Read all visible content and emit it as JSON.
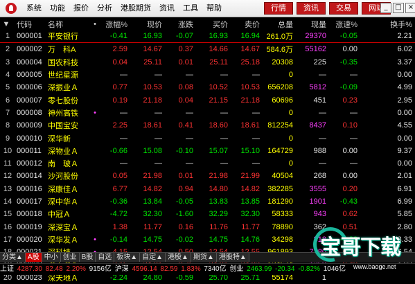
{
  "menu": [
    "系统",
    "功能",
    "报价",
    "分析",
    "港股期货",
    "资讯",
    "工具",
    "帮助"
  ],
  "modes": [
    "行情",
    "资讯",
    "交易",
    "网站"
  ],
  "window_buttons": [
    "_",
    "□",
    "×"
  ],
  "table": {
    "corner": "▼",
    "headers": [
      "",
      "代码",
      "名称",
      "•",
      "涨幅%",
      "现价",
      "涨跌",
      "买价",
      "卖价",
      "总量",
      "现量",
      "涨速%",
      "换手%"
    ],
    "rows": [
      {
        "no": "1",
        "code": "000001",
        "name": "平安银行",
        "mark": "",
        "pct": "-0.41",
        "price": "16.93",
        "chg": "-0.07",
        "bid": "16.93",
        "ask": "16.94",
        "vol": "261.0万",
        "cur": "29370",
        "spd": "-0.05",
        "turn": "2.21",
        "dir": "down",
        "curc": "mag",
        "spdc": "down"
      },
      {
        "no": "2",
        "code": "000002",
        "name": "万　科A",
        "mark": "",
        "pct": "2.59",
        "price": "14.67",
        "chg": "0.37",
        "bid": "14.66",
        "ask": "14.67",
        "vol": "584.6万",
        "cur": "55162",
        "spd": "0.00",
        "turn": "6.02",
        "dir": "up",
        "curc": "mag",
        "spdc": "wht"
      },
      {
        "no": "3",
        "code": "000004",
        "name": "国农科技",
        "mark": "",
        "pct": "0.04",
        "price": "25.11",
        "chg": "0.01",
        "bid": "25.11",
        "ask": "25.18",
        "vol": "20308",
        "cur": "225",
        "spd": "-0.35",
        "turn": "3.37",
        "dir": "up",
        "curc": "wht",
        "spdc": "down"
      },
      {
        "no": "4",
        "code": "000005",
        "name": "世纪星源",
        "mark": "",
        "pct": "—",
        "price": "—",
        "chg": "—",
        "bid": "—",
        "ask": "—",
        "vol": "0",
        "cur": "—",
        "spd": "—",
        "turn": "0.00",
        "dir": "dash",
        "curc": "wht",
        "spdc": "wht"
      },
      {
        "no": "5",
        "code": "000006",
        "name": "深振业Ａ",
        "mark": "",
        "pct": "0.77",
        "price": "10.53",
        "chg": "0.08",
        "bid": "10.52",
        "ask": "10.53",
        "vol": "656208",
        "cur": "5812",
        "spd": "-0.09",
        "turn": "4.99",
        "dir": "up",
        "curc": "mag",
        "spdc": "down"
      },
      {
        "no": "6",
        "code": "000007",
        "name": "零七股份",
        "mark": "",
        "pct": "0.19",
        "price": "21.18",
        "chg": "0.04",
        "bid": "21.15",
        "ask": "21.18",
        "vol": "60696",
        "cur": "451",
        "spd": "0.23",
        "turn": "2.95",
        "dir": "up",
        "curc": "wht",
        "spdc": "up"
      },
      {
        "no": "7",
        "code": "000008",
        "name": "神州高铁",
        "mark": "•",
        "pct": "—",
        "price": "—",
        "chg": "—",
        "bid": "—",
        "ask": "—",
        "vol": "0",
        "cur": "—",
        "spd": "—",
        "turn": "0.00",
        "dir": "dash",
        "curc": "wht",
        "spdc": "wht"
      },
      {
        "no": "8",
        "code": "000009",
        "name": "中国宝安",
        "mark": "",
        "pct": "2.25",
        "price": "18.61",
        "chg": "0.41",
        "bid": "18.60",
        "ask": "18.61",
        "vol": "812254",
        "cur": "8437",
        "spd": "0.10",
        "turn": "4.55",
        "dir": "up",
        "curc": "mag",
        "spdc": "up"
      },
      {
        "no": "9",
        "code": "000010",
        "name": "深华新",
        "mark": "",
        "pct": "—",
        "price": "—",
        "chg": "—",
        "bid": "—",
        "ask": "—",
        "vol": "0",
        "cur": "—",
        "spd": "—",
        "turn": "0.00",
        "dir": "dash",
        "curc": "wht",
        "spdc": "wht"
      },
      {
        "no": "10",
        "code": "000011",
        "name": "深物业Ａ",
        "mark": "",
        "pct": "-0.66",
        "price": "15.08",
        "chg": "-0.10",
        "bid": "15.07",
        "ask": "15.10",
        "vol": "164729",
        "cur": "988",
        "spd": "0.00",
        "turn": "9.37",
        "dir": "down",
        "curc": "wht",
        "spdc": "wht"
      },
      {
        "no": "11",
        "code": "000012",
        "name": "南　玻Ａ",
        "mark": "",
        "pct": "—",
        "price": "—",
        "chg": "—",
        "bid": "—",
        "ask": "—",
        "vol": "0",
        "cur": "—",
        "spd": "—",
        "turn": "0.00",
        "dir": "dash",
        "curc": "wht",
        "spdc": "wht"
      },
      {
        "no": "12",
        "code": "000014",
        "name": "沙河股份",
        "mark": "",
        "pct": "0.05",
        "price": "21.98",
        "chg": "0.01",
        "bid": "21.98",
        "ask": "21.99",
        "vol": "40504",
        "cur": "268",
        "spd": "0.00",
        "turn": "2.01",
        "dir": "up",
        "curc": "wht",
        "spdc": "wht"
      },
      {
        "no": "13",
        "code": "000016",
        "name": "深康佳Ａ",
        "mark": "",
        "pct": "6.77",
        "price": "14.82",
        "chg": "0.94",
        "bid": "14.80",
        "ask": "14.82",
        "vol": "382285",
        "cur": "3555",
        "spd": "0.20",
        "turn": "6.91",
        "dir": "up",
        "curc": "mag",
        "spdc": "up"
      },
      {
        "no": "14",
        "code": "000017",
        "name": "深中华Ａ",
        "mark": "",
        "pct": "-0.36",
        "price": "13.84",
        "chg": "-0.05",
        "bid": "13.83",
        "ask": "13.85",
        "vol": "181290",
        "cur": "1901",
        "spd": "-0.43",
        "turn": "6.99",
        "dir": "down",
        "curc": "mag",
        "spdc": "down"
      },
      {
        "no": "15",
        "code": "000018",
        "name": "中冠Ａ",
        "mark": "",
        "pct": "-4.72",
        "price": "32.30",
        "chg": "-1.60",
        "bid": "32.29",
        "ask": "32.30",
        "vol": "58333",
        "cur": "943",
        "spd": "0.62",
        "turn": "5.85",
        "dir": "down",
        "curc": "mag",
        "spdc": "up"
      },
      {
        "no": "16",
        "code": "000019",
        "name": "深深宝Ａ",
        "mark": "",
        "pct": "1.38",
        "price": "11.77",
        "chg": "0.16",
        "bid": "11.76",
        "ask": "11.77",
        "vol": "78890",
        "cur": "362",
        "spd": "0.51",
        "turn": "2.80",
        "dir": "up",
        "curc": "wht",
        "spdc": "up"
      },
      {
        "no": "17",
        "code": "000020",
        "name": "深华发Ａ",
        "mark": "•",
        "pct": "-0.14",
        "price": "14.75",
        "chg": "-0.02",
        "bid": "14.75",
        "ask": "14.76",
        "vol": "34298",
        "cur": "818",
        "spd": "-0.33",
        "turn": "8.33",
        "dir": "down",
        "curc": "mag",
        "spdc": "down"
      },
      {
        "no": "18",
        "code": "000021",
        "name": "深科技",
        "mark": "•",
        "pct": "4.15",
        "price": "12.54",
        "chg": "0.50",
        "bid": "12.54",
        "ask": "12.55",
        "vol": "961893",
        "cur": "7780",
        "spd": "0.31",
        "turn": "6.54",
        "dir": "up",
        "curc": "mag",
        "spdc": "up"
      },
      {
        "no": "19",
        "code": "000022",
        "name": "深赤湾Ａ",
        "mark": "",
        "pct": "3.16",
        "price": "24.81",
        "chg": "0.76",
        "bid": "24.81",
        "ask": "24.82",
        "vol": "124674",
        "cur": "1250",
        "spd": "0.40",
        "turn": "1.93",
        "dir": "up",
        "curc": "mag",
        "spdc": "up"
      },
      {
        "no": "20",
        "code": "000023",
        "name": "深天地Ａ",
        "mark": "",
        "pct": "-2.24",
        "price": "24.80",
        "chg": "-0.59",
        "bid": "25.70",
        "ask": "25.71",
        "vol": "55174",
        "cur": "1",
        "spd": "",
        "turn": "",
        "dir": "down",
        "curc": "wht",
        "spdc": "wht"
      }
    ]
  },
  "tabs": [
    "分类▲",
    "A股",
    "中小",
    "创业",
    "B股",
    "自选",
    "板块▲",
    "自定▲",
    "港股▲",
    "期货▲",
    "港股特▲"
  ],
  "tabs_active": "A股",
  "status": {
    "sh_label": "上证",
    "sh_value": "4287.30",
    "sh_chg": "82.48",
    "sh_pct": "2.20%",
    "sh_amt": "9156亿",
    "hs_label": "沪深",
    "hs_value": "4596.14",
    "hs_chg": "82.59",
    "hs_pct": "1.83%",
    "hs_amt": "7340亿",
    "cy_label": "创业",
    "cy_value": "2463.99",
    "cy_chg": "-20.34",
    "cy_pct": "-0.82%",
    "cy_amt": "1046亿"
  },
  "watermark": {
    "text": "宝哥下载",
    "url": "www.baoge.net"
  },
  "colors": {
    "up": "#ff3333",
    "down": "#00e600",
    "vol": "#ffff00",
    "cur": "#ff40ff",
    "tab_active": "#cc0000",
    "mode_btn": "#c0181a"
  }
}
